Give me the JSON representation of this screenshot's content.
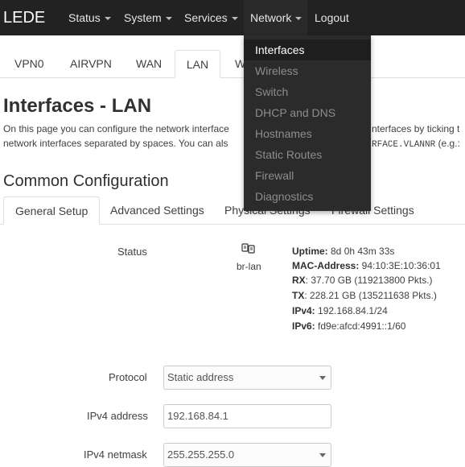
{
  "navbar": {
    "brand": "LEDE",
    "menus": [
      {
        "label": "Status"
      },
      {
        "label": "System"
      },
      {
        "label": "Services"
      },
      {
        "label": "Network"
      }
    ],
    "logout": "Logout"
  },
  "network_menu": {
    "items": [
      "Interfaces",
      "Wireless",
      "Switch",
      "DHCP and DNS",
      "Hostnames",
      "Static Routes",
      "Firewall",
      "Diagnostics"
    ],
    "active": "Interfaces"
  },
  "interface_tabs": [
    "VPN0",
    "AIRVPN",
    "WAN",
    "LAN",
    "W"
  ],
  "active_interface_tab": "LAN",
  "page": {
    "title": "Interfaces - LAN",
    "desc_line1": "On this page you can configure the network interface",
    "desc_line1_right": "nterfaces by ticking t",
    "desc_line2_left": "network interfaces separated by spaces. You can als",
    "desc_line2_right_mono": "RFACE.VLANNR",
    "desc_line2_right": " (e.g.:",
    "section_title": "Common Configuration"
  },
  "config_tabs": [
    "General Setup",
    "Advanced Settings",
    "Physical Settings",
    "Firewall Settings"
  ],
  "active_config_tab": "General Setup",
  "status": {
    "label": "Status",
    "interface": "br-lan",
    "lines": [
      {
        "key": "Uptime:",
        "value": " 8d 0h 43m 33s"
      },
      {
        "key": "MAC-Address:",
        "value": " 94:10:3E:10:36:01"
      },
      {
        "key": "RX",
        "value": ": 37.70 GB (119213800 Pkts.)"
      },
      {
        "key": "TX",
        "value": ": 228.21 GB (135211638 Pkts.)"
      },
      {
        "key": "IPv4:",
        "value": " 192.168.84.1/24"
      },
      {
        "key": "IPv6:",
        "value": " fd9e:afcd:4991::1/60"
      }
    ]
  },
  "form": {
    "protocol_label": "Protocol",
    "protocol_value": "Static address",
    "ipv4_address_label": "IPv4 address",
    "ipv4_address_value": "192.168.84.1",
    "ipv4_netmask_label": "IPv4 netmask",
    "ipv4_netmask_value": "255.255.255.0"
  },
  "colors": {
    "navbar_bg": "#222222",
    "dropdown_bg": "#2b2b2b",
    "dropdown_active_bg": "#1e1e1e"
  }
}
